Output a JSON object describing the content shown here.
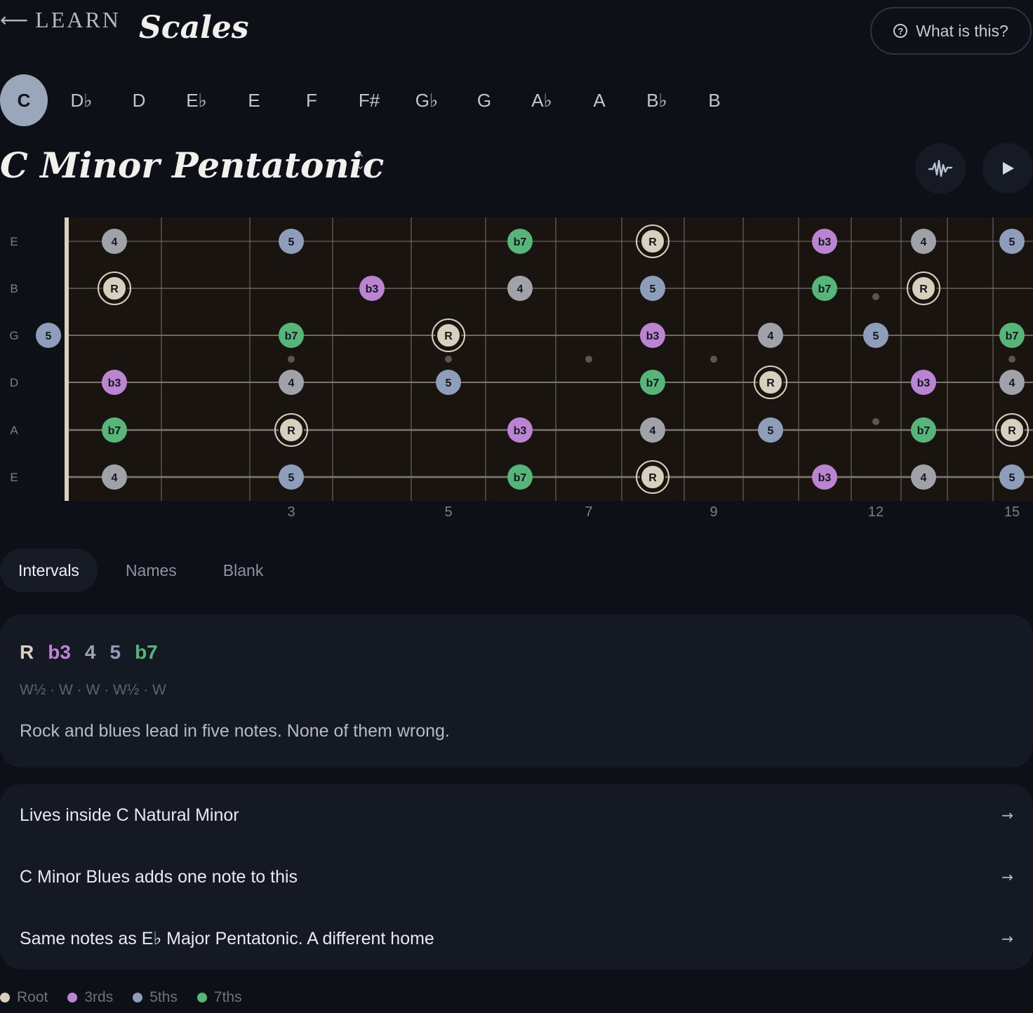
{
  "header": {
    "back_label": "LEARN",
    "title": "Scales",
    "help_label": "What is this?"
  },
  "keys": {
    "items": [
      "C",
      "D♭",
      "D",
      "E♭",
      "E",
      "F",
      "F#",
      "G♭",
      "G",
      "A♭",
      "A",
      "B♭",
      "B"
    ],
    "selected": "C"
  },
  "scale": {
    "title": "C Minor Pentatonic"
  },
  "colors": {
    "root": "#d8d0bf",
    "third": "#bb84d2",
    "fourth": "#9fa2a9",
    "fifth": "#8d9dba",
    "seventh": "#57b57a",
    "board": "#1a1411"
  },
  "fretboard": {
    "strings": [
      "E",
      "B",
      "G",
      "D",
      "A",
      "E"
    ],
    "fret_numbers": [
      "3",
      "5",
      "7",
      "9",
      "12",
      "15"
    ],
    "notes": [
      {
        "string": 0,
        "fret": 1,
        "label": "4"
      },
      {
        "string": 0,
        "fret": 3,
        "label": "5"
      },
      {
        "string": 0,
        "fret": 6,
        "label": "b7"
      },
      {
        "string": 0,
        "fret": 8,
        "label": "R"
      },
      {
        "string": 0,
        "fret": 11,
        "label": "b3"
      },
      {
        "string": 0,
        "fret": 13,
        "label": "4"
      },
      {
        "string": 0,
        "fret": 15,
        "label": "5"
      },
      {
        "string": 1,
        "fret": 1,
        "label": "R"
      },
      {
        "string": 1,
        "fret": 4,
        "label": "b3"
      },
      {
        "string": 1,
        "fret": 6,
        "label": "4"
      },
      {
        "string": 1,
        "fret": 8,
        "label": "5"
      },
      {
        "string": 1,
        "fret": 11,
        "label": "b7"
      },
      {
        "string": 1,
        "fret": 13,
        "label": "R"
      },
      {
        "string": 2,
        "fret": 0,
        "label": "5"
      },
      {
        "string": 2,
        "fret": 3,
        "label": "b7"
      },
      {
        "string": 2,
        "fret": 5,
        "label": "R"
      },
      {
        "string": 2,
        "fret": 8,
        "label": "b3"
      },
      {
        "string": 2,
        "fret": 10,
        "label": "4"
      },
      {
        "string": 2,
        "fret": 12,
        "label": "5"
      },
      {
        "string": 2,
        "fret": 15,
        "label": "b7"
      },
      {
        "string": 3,
        "fret": 1,
        "label": "b3"
      },
      {
        "string": 3,
        "fret": 3,
        "label": "4"
      },
      {
        "string": 3,
        "fret": 5,
        "label": "5"
      },
      {
        "string": 3,
        "fret": 8,
        "label": "b7"
      },
      {
        "string": 3,
        "fret": 10,
        "label": "R"
      },
      {
        "string": 3,
        "fret": 13,
        "label": "b3"
      },
      {
        "string": 3,
        "fret": 15,
        "label": "4"
      },
      {
        "string": 4,
        "fret": 1,
        "label": "b7"
      },
      {
        "string": 4,
        "fret": 3,
        "label": "R"
      },
      {
        "string": 4,
        "fret": 6,
        "label": "b3"
      },
      {
        "string": 4,
        "fret": 8,
        "label": "4"
      },
      {
        "string": 4,
        "fret": 10,
        "label": "5"
      },
      {
        "string": 4,
        "fret": 13,
        "label": "b7"
      },
      {
        "string": 4,
        "fret": 15,
        "label": "R"
      },
      {
        "string": 5,
        "fret": 1,
        "label": "4"
      },
      {
        "string": 5,
        "fret": 3,
        "label": "5"
      },
      {
        "string": 5,
        "fret": 6,
        "label": "b7"
      },
      {
        "string": 5,
        "fret": 8,
        "label": "R"
      },
      {
        "string": 5,
        "fret": 11,
        "label": "b3"
      },
      {
        "string": 5,
        "fret": 13,
        "label": "4"
      },
      {
        "string": 5,
        "fret": 15,
        "label": "5"
      }
    ]
  },
  "tabs": [
    "Intervals",
    "Names",
    "Blank"
  ],
  "info": {
    "intervals": [
      "R",
      "b3",
      "4",
      "5",
      "b7"
    ],
    "steps": "W½ · W · W · W½ · W",
    "description": "Rock and blues lead in five notes. None of them wrong."
  },
  "related": [
    "Lives inside C Natural Minor",
    "C Minor Blues adds one note to this",
    "Same notes as E♭ Major Pentatonic. A different home"
  ],
  "legend": [
    "Root",
    "3rds",
    "5ths",
    "7ths"
  ]
}
